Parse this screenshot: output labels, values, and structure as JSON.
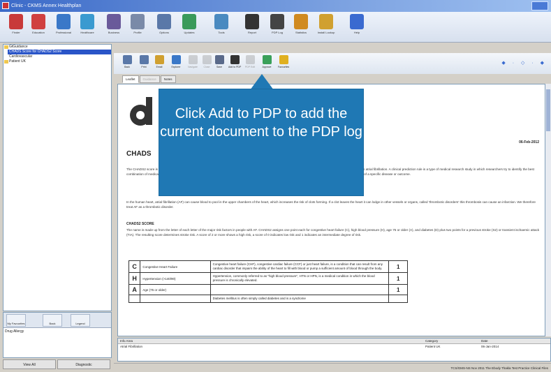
{
  "window": {
    "title": "Clinic - CKMS Annex Healthplan"
  },
  "main_toolbar": {
    "buttons": [
      {
        "label": "Finder",
        "color": "#c83a3a"
      },
      {
        "label": "Education",
        "color": "#d04040"
      },
      {
        "label": "Professional",
        "color": "#3a78c8"
      },
      {
        "label": "Healthcare",
        "color": "#3a9ad0"
      },
      {
        "label": "Business",
        "color": "#6a5a9a"
      },
      {
        "label": "Profile",
        "color": "#7a8aa8"
      },
      {
        "label": "Options",
        "color": "#5a78a8"
      },
      {
        "label": "Updates",
        "color": "#3a9a5a"
      },
      {
        "label": "Tools",
        "color": "#4a8ac0"
      },
      {
        "label": "Report",
        "color": "#333333"
      },
      {
        "label": "PDP Log",
        "color": "#444444"
      },
      {
        "label": "Statistics",
        "color": "#d08a20"
      },
      {
        "label": "Install Lookup",
        "color": "#d0a030"
      },
      {
        "label": "Help",
        "color": "#3a6ad0"
      }
    ]
  },
  "tree": {
    "items": [
      {
        "label": "GtGuidance",
        "type": "folder"
      },
      {
        "label": "CHADS Score for CHADS2 Score",
        "type": "selected"
      },
      {
        "label": "Cardiovascular",
        "type": "plain"
      },
      {
        "label": "Patient UK",
        "type": "folder"
      }
    ]
  },
  "left_lower": {
    "buttons": [
      "My Favourites",
      "Back",
      "Legend"
    ],
    "label": "Drug Allergy"
  },
  "bottom_tabs": [
    "View All",
    "Diagnostic"
  ],
  "doc_toolbar": {
    "buttons": [
      {
        "label": "Back",
        "disabled": false,
        "color": "#5a78a8"
      },
      {
        "label": "Print",
        "disabled": false,
        "color": "#5a78a8"
      },
      {
        "label": "Email",
        "disabled": false,
        "color": "#d0a030"
      },
      {
        "label": "Explorer",
        "disabled": false,
        "color": "#3a78c8"
      },
      {
        "label": "Navigate",
        "disabled": true,
        "color": "#8a8a8a"
      },
      {
        "label": "Close",
        "disabled": true,
        "color": "#8a8a8a"
      },
      {
        "label": "Save",
        "disabled": false,
        "color": "#5a6a8a"
      },
      {
        "label": "Add to PDP",
        "disabled": false,
        "color": "#333333"
      },
      {
        "label": "PDP Edit",
        "disabled": true,
        "color": "#8a8a8a"
      },
      {
        "label": "Approve",
        "disabled": false,
        "color": "#3aa05a"
      },
      {
        "label": "Favourites",
        "disabled": false,
        "color": "#e0b020"
      }
    ],
    "nav": "◆ · ◇ · ◆"
  },
  "doc_tabs": [
    {
      "label": "Leaflet",
      "state": "active"
    },
    {
      "label": "Guidance",
      "state": "off"
    },
    {
      "label": "Notes",
      "state": "normal"
    }
  ],
  "document": {
    "date": "06-Feb-2012",
    "heading": "CHADS",
    "para1": "The CHADS2 score is a clinical prediction rule and it is recommended by the National Institute of Clinical Excellence (NICE) for estimating the stroke risk in patients with atrial fibrillation. A clinical prediction rule is a type of medical research study in which researchers try to identify the best combination of medical signs, symptoms and other findings in predicting the probability of a specific disease or outcome. Researchers use this to predict the probability of a specific disease or outcome.",
    "para2": "In the human heart, atrial fibrillation (AF) can cause blood to pool in the upper chambers of the heart, which increases the risk of clots forming. If a clot leaves the heart it can lodge in other vessels or organs, called 'thrombotic disorders' this thrombosis can cause an infarction. We therefore treat AF as a thrombotic disorder.",
    "section_heading": "CHADS2 SCORE",
    "para3": "The name is made up from the letter of each letter of the major risk factors in people with AF. CHADS2 assigns one point each for congestive heart failure (C), high blood pressure (H), age 75 or older (A), and diabetes (D) plus two points for a previous stroke (S2) or transient ischaemic attack (TIA). The resulting score determines stroke risk. A score of 2 or more shows a high risk, a score of 0 indicates low risk and 1 indicates an intermediate degree of risk.",
    "table": [
      {
        "letter": "C",
        "name": "Congestive Heart Failure",
        "desc": "Congestive heart failure (CHF), congestive cardiac failure (CCF) or just heart failure, is a condition that can result from any cardiac disorder that impairs the ability of the heart to fill with blood or pump a sufficient amount of blood through the body.",
        "points": "1"
      },
      {
        "letter": "H",
        "name": "Hypertension (>140/90)",
        "desc": "Hypertension, commonly referred to as \"high blood pressure\", HTN or HPN, is a medical condition in which the blood pressure is chronically elevated.",
        "points": "1"
      },
      {
        "letter": "A",
        "name": "Age (75 or older)",
        "desc": "",
        "points": "1"
      },
      {
        "letter": "",
        "name": "",
        "desc": "Diabetes mellitus is often simply called diabetes and is a syndrome",
        "points": ""
      }
    ]
  },
  "log": {
    "headers": [
      "Info Area",
      "Category",
      "Date"
    ],
    "row": [
      "Atrial Fibrillation",
      "Patient UK",
      "06-Jan-2014"
    ]
  },
  "status": "TCS/GMS-NS   Nov 2011   The Ebody Thakla Test Practice   Clinical Files",
  "callout": {
    "text": "Click Add to PDP to add the current document to the PDP log"
  }
}
